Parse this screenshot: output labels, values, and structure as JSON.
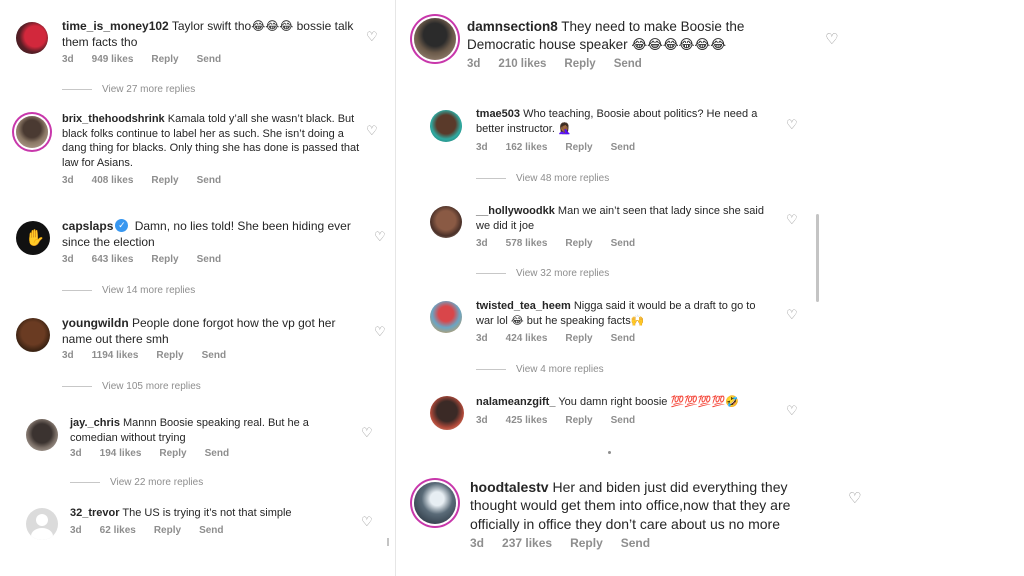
{
  "labels": {
    "reply": "Reply",
    "send": "Send"
  },
  "icons": {
    "like": "heart-outline-icon"
  },
  "left_comments": [
    {
      "username": "time_is_money102",
      "text": "Taylor swift tho😂😂😂 bossie talk them facts tho",
      "time": "3d",
      "likes": "949 likes"
    },
    {
      "username": "brix_thehoodshrink",
      "text": "Kamala told y’all she wasn’t black. But black folks continue to label her as such. She isn’t doing a dang thing for blacks. Only thing she has done is passed that law for Asians.",
      "time": "3d",
      "likes": "408 likes"
    },
    {
      "username": "capslaps",
      "text": "Damn, no lies told! She been hiding ever since the election",
      "time": "3d",
      "likes": "643 likes",
      "verified": true
    },
    {
      "username": "youngwildn",
      "text": "People done forgot how the vp got her name out there smh",
      "time": "3d",
      "likes": "1194 likes"
    },
    {
      "username": "jay._chris",
      "text": "Mannn Boosie speaking real. But he a comedian without trying",
      "time": "3d",
      "likes": "194 likes"
    },
    {
      "username": "32_trevor",
      "text": "The US is trying it’s not that simple",
      "time": "3d",
      "likes": "62 likes"
    }
  ],
  "left_view_replies": [
    "View 27 more replies",
    "View 14 more replies",
    "View 105 more replies",
    "View 22 more replies"
  ],
  "right_main": {
    "username": "damnsection8",
    "text": "They need to make Boosie the Democratic house speaker 😂😂😂😂😂😂",
    "time": "3d",
    "likes": "210 likes"
  },
  "right_comments": [
    {
      "username": "tmae503",
      "text": "Who teaching, Boosie about politics? He need a better instructor. 🤦🏾‍♀️",
      "time": "3d",
      "likes": "162 likes"
    },
    {
      "username": "__hollywoodkk",
      "text": "Man we ain’t seen that lady since she said we did it joe",
      "time": "3d",
      "likes": "578 likes"
    },
    {
      "username": "twisted_tea_heem",
      "text": "Nigga said it would be a draft to go to war lol 😂 but he speaking facts🙌",
      "time": "3d",
      "likes": "424 likes"
    },
    {
      "username": "nalameanzgift_",
      "text": "You damn right boosie 💯💯💯💯🤣",
      "time": "3d",
      "likes": "425 likes"
    }
  ],
  "right_view_replies": [
    "View 48 more replies",
    "View 32 more replies",
    "View 4 more replies"
  ],
  "right_bottom": {
    "username": "hoodtalestv",
    "text": "Her and biden just did everything they thought would get them into office,now that they are officially in office they don’t care about us no more",
    "time": "3d",
    "likes": "237 likes"
  }
}
